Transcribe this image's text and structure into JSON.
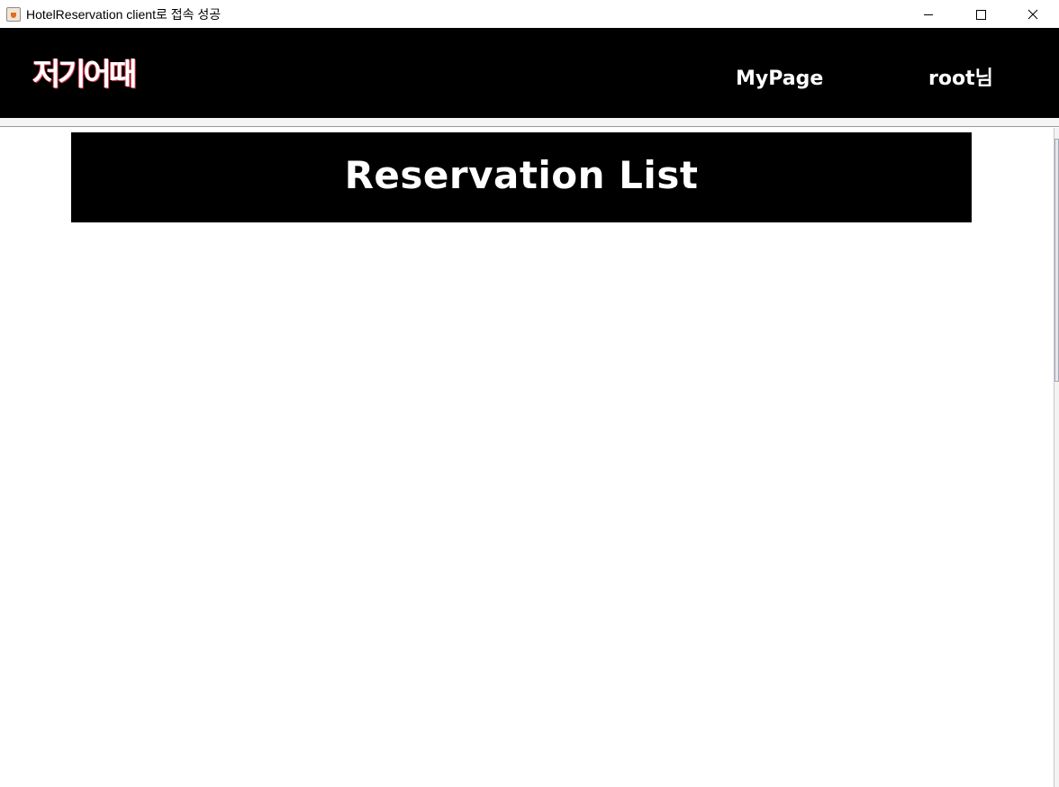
{
  "window": {
    "title": "HotelReservation client로 접속 성공",
    "app_icon": "java-cup-icon",
    "controls": [
      "minimize-icon",
      "maximize-icon",
      "close-icon"
    ]
  },
  "header": {
    "logo": "저기어때",
    "nav": {
      "mypage_label": "MyPage",
      "user_label": "root님"
    },
    "background_color": "#000000",
    "text_color": "#ffffff"
  },
  "main": {
    "banner_title": "Reservation List"
  }
}
